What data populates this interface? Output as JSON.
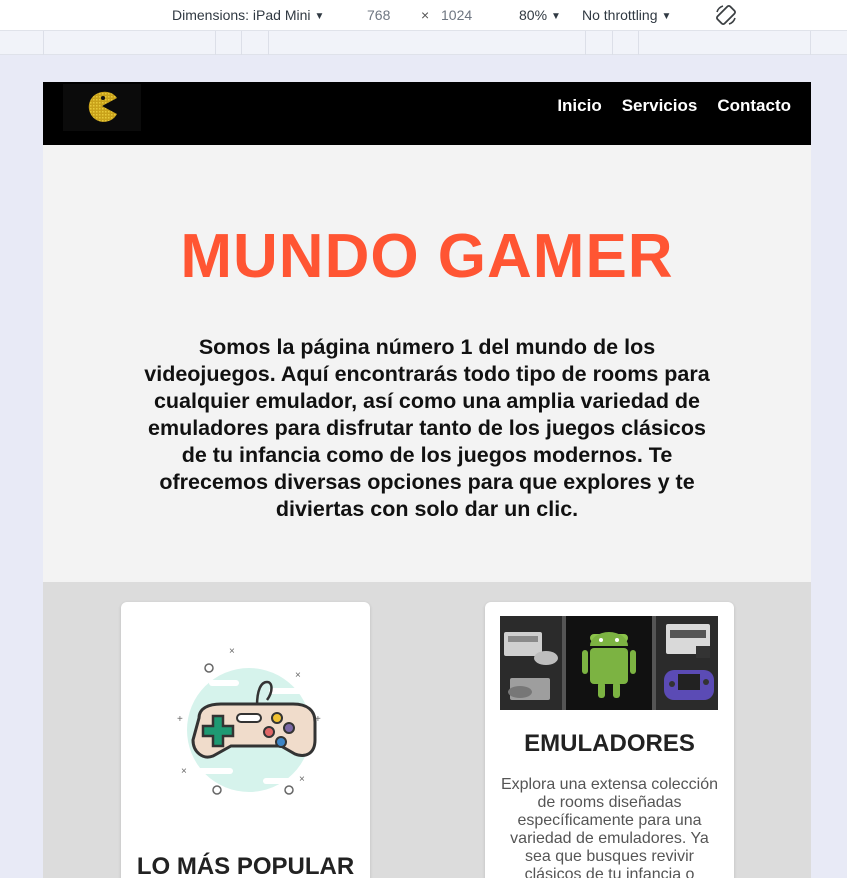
{
  "devtools": {
    "dimensions_label": "Dimensions: iPad Mini",
    "width_value": "768",
    "times": "×",
    "height_value": "1024",
    "zoom_label": "80%",
    "throttling_label": "No throttling",
    "dropdown_arrow": "▼"
  },
  "nav": {
    "links": [
      "Inicio",
      "Servicios",
      "Contacto"
    ]
  },
  "hero": {
    "title": "MUNDO GAMER",
    "description": "Somos la página número 1 del mundo de los videojuegos. Aquí encontrarás todo tipo de rooms para cualquier emulador, así como una amplia variedad de emuladores para disfrutar tanto de los juegos clásicos de tu infancia como de los juegos modernos. Te ofrecemos diversas opciones para que explores y te diviertas con solo dar un clic."
  },
  "cards": [
    {
      "title": "LO MÁS POPULAR",
      "icon": "gamepad-icon"
    },
    {
      "title": "EMULADORES",
      "image": "consoles-image",
      "text": "Explora una extensa colección de rooms diseñadas específicamente para una variedad de emuladores. Ya sea que busques revivir clásicos de tu infancia o"
    }
  ],
  "colors": {
    "accent": "#ff5533",
    "navbar": "#000000",
    "hero_bg": "#f3f3f3",
    "cards_bg": "#dcdcdc"
  }
}
